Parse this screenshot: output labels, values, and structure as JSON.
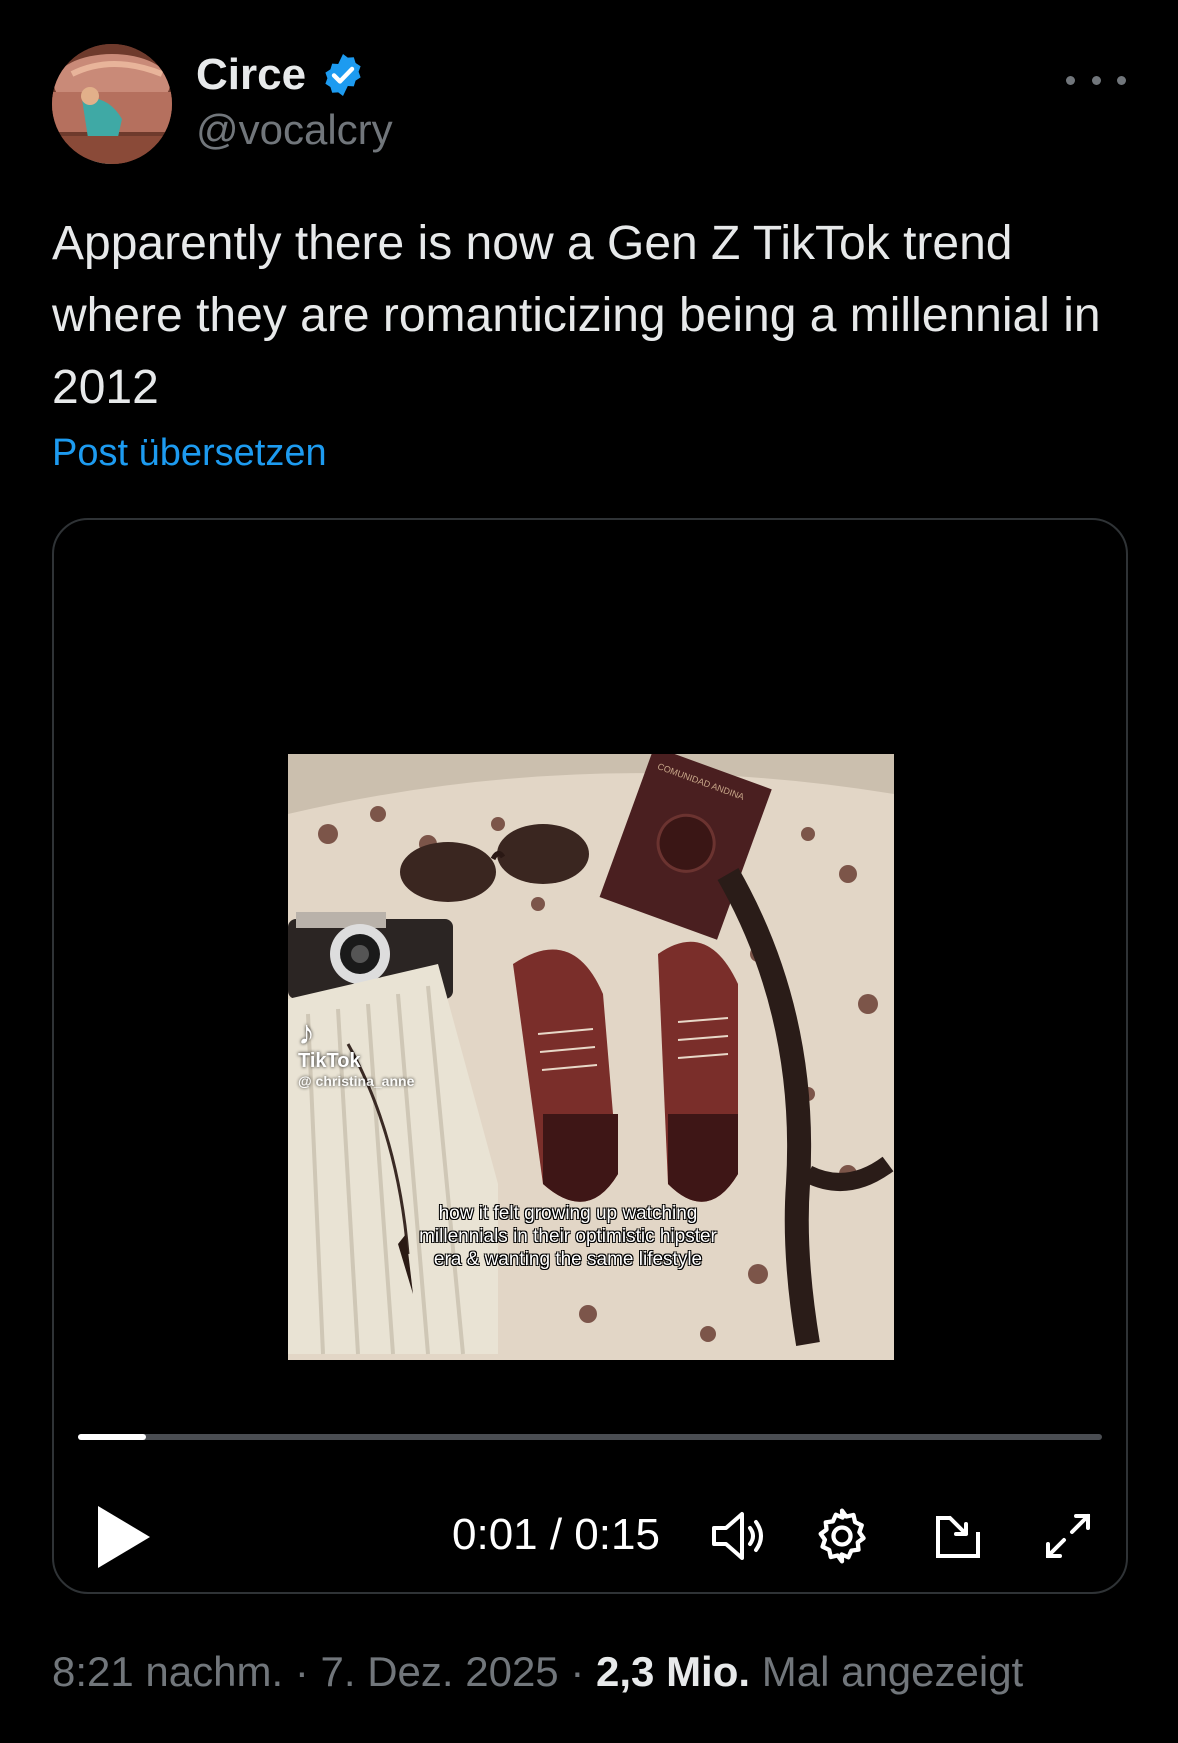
{
  "author": {
    "display_name": "Circe",
    "handle": "@vocalcry",
    "verified": true,
    "verified_color": "#1d9bf0"
  },
  "tweet": {
    "text": "Apparently there is now a Gen Z TikTok trend where they are romanticizing being a millennial in 2012",
    "translate_label": "Post übersetzen"
  },
  "video": {
    "watermark_brand": "TikTok",
    "watermark_user": "@ christina_anne",
    "caption": "how it felt growing up watching millennials in their optimistic hipster era & wanting the same lifestyle",
    "passport_text": "COMUNIDAD ANDINA",
    "time_display": "0:01 / 0:15",
    "progress_fraction": 0.0667
  },
  "meta": {
    "time": "8:21 nachm.",
    "separator": "·",
    "date": "7. Dez. 2025",
    "views_count": "2,3 Mio.",
    "views_label": "Mal angezeigt"
  },
  "icons": {
    "more": "more-horizontal-icon",
    "play": "play-icon",
    "volume": "volume-icon",
    "settings": "gear-icon",
    "pip": "picture-in-picture-icon",
    "fullscreen": "expand-icon"
  }
}
